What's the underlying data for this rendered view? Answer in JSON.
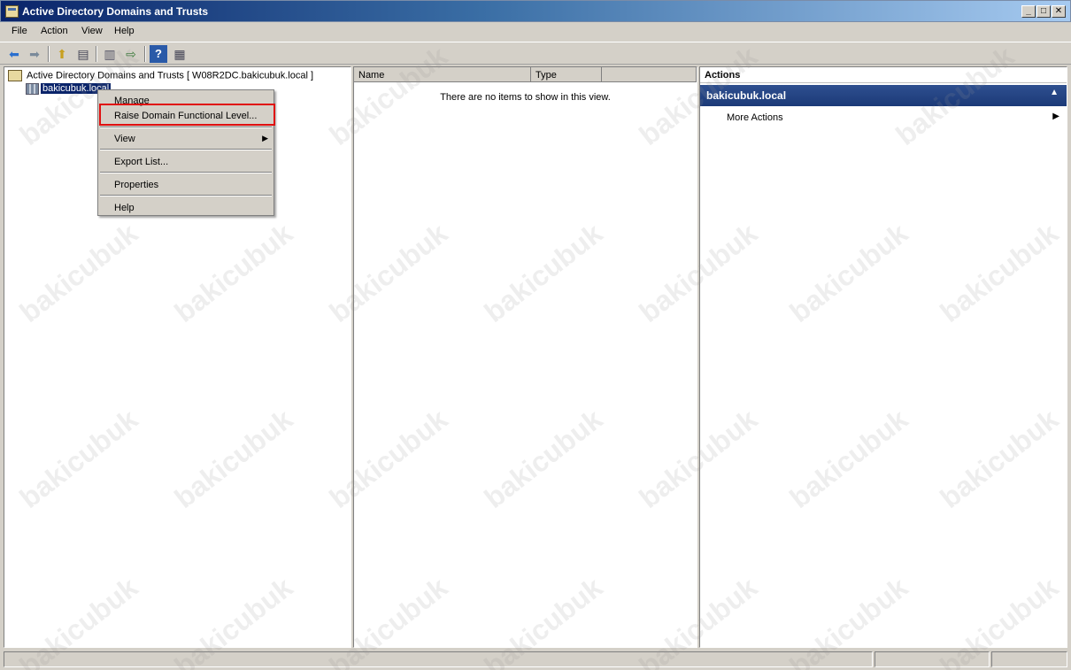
{
  "window": {
    "title": "Active Directory Domains and Trusts",
    "minimize": "_",
    "maximize": "□",
    "close": "✕"
  },
  "menubar": [
    "File",
    "Action",
    "View",
    "Help"
  ],
  "tree": {
    "root": "Active Directory Domains and Trusts [ W08R2DC.bakicubuk.local ]",
    "child": "bakicubuk.local"
  },
  "list": {
    "columns": [
      "Name",
      "Type"
    ],
    "empty_message": "There are no items to show in this view."
  },
  "actions": {
    "header": "Actions",
    "section": "bakicubuk.local",
    "more": "More Actions"
  },
  "context_menu": {
    "items": [
      "Manage",
      "Raise Domain Functional Level...",
      "View",
      "Export List...",
      "Properties",
      "Help"
    ]
  },
  "watermark": "bakicubuk",
  "colors": {
    "selection": "#0a246a",
    "highlight_box": "#e01010",
    "actions_header": "#1c3a78"
  }
}
